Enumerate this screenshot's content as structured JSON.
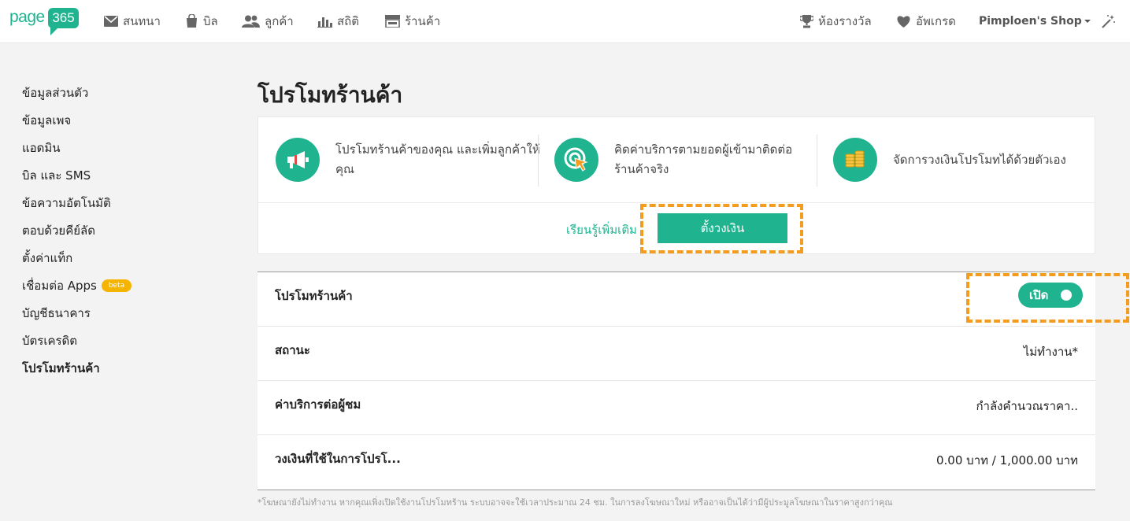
{
  "header": {
    "logo_text": "page",
    "logo_badge": "365",
    "nav": [
      {
        "label": "สนทนา",
        "icon": "mail-icon"
      },
      {
        "label": "บิล",
        "icon": "bag-icon"
      },
      {
        "label": "ลูกค้า",
        "icon": "users-icon"
      },
      {
        "label": "สถิติ",
        "icon": "bar-chart-icon"
      },
      {
        "label": "ร้านค้า",
        "icon": "store-icon"
      }
    ],
    "right": {
      "awards": "ห้องรางวัล",
      "upgrade": "อัพเกรด",
      "shop": "Pimploen's Shop"
    }
  },
  "sidebar": {
    "items": [
      {
        "label": "ข้อมูลส่วนตัว"
      },
      {
        "label": "ข้อมูลเพจ"
      },
      {
        "label": "แอดมิน"
      },
      {
        "label": "บิล และ SMS"
      },
      {
        "label": "ข้อความอัตโนมัติ"
      },
      {
        "label": "ตอบด้วยคีย์ลัด"
      },
      {
        "label": "ตั้งค่าแท็ก"
      },
      {
        "label": "เชื่อมต่อ Apps",
        "badge": "beta"
      },
      {
        "label": "บัญชีธนาคาร"
      },
      {
        "label": "บัตรเครดิต"
      },
      {
        "label": "โปรโมทร้านค้า",
        "active": true
      }
    ]
  },
  "main": {
    "title": "โปรโมทร้านค้า",
    "features": [
      {
        "line1": "โปรโมทร้านค้าของคุณ และเพิ่มลูกค้าให้",
        "line2": "คุณ"
      },
      {
        "line1": "คิดค่าบริการตามยอดผู้เข้ามาติดต่อ",
        "line2": "ร้านค้าจริง"
      },
      {
        "line1": "จัดการวงเงินโปรโมทได้ด้วยตัวเอง",
        "line2": ""
      }
    ],
    "learn_more": "เรียนรู้เพิ่มเติม",
    "set_budget": "ตั้งวงเงิน",
    "rows": [
      {
        "label": "โปรโมทร้านค้า",
        "toggle": "เปิด"
      },
      {
        "label": "สถานะ",
        "value": "ไม่ทำงาน*"
      },
      {
        "label": "ค่าบริการต่อผู้ชม",
        "value": "กำลังคำนวณราคา.."
      },
      {
        "label": "วงเงินที่ใช้ในการโปรโ...",
        "value": "0.00 บาท / 1,000.00 บาท"
      }
    ],
    "footnote": "*โฆษณายังไม่ทำงาน หากคุณเพิ่งเปิดใช้งานโปรโมทร้าน ระบบอาจจะใช้เวลาประมาณ 24 ชม. ในการลงโฆษณาใหม่ หรืออาจเป็นได้ว่ามีผู้ประมูลโฆษณาในราคาสูงกว่าคุณ"
  },
  "colors": {
    "accent": "#1fb48f",
    "highlight": "#f39c1f",
    "beta": "#f5b400"
  }
}
